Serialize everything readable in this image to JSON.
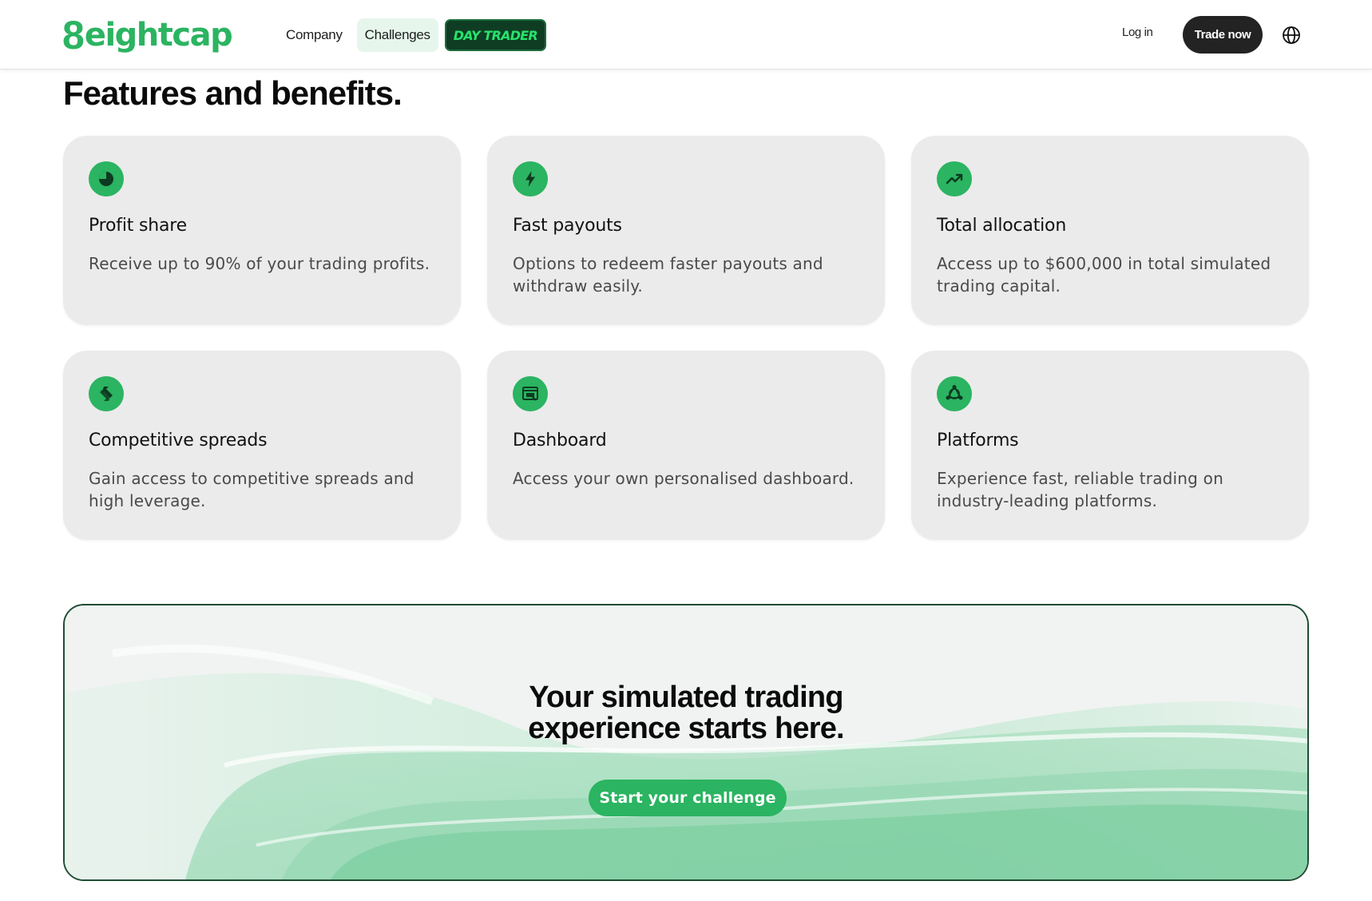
{
  "nav": {
    "logo_mark": "8",
    "logo_word": "eightcap",
    "links": [
      {
        "label": "Company"
      },
      {
        "label": "Challenges"
      }
    ],
    "badge_label": "DAY TRADER",
    "login_label": "Log in",
    "trade_label": "Trade now",
    "globe_icon": "globe-icon"
  },
  "features": {
    "title": "Features and benefits.",
    "cards": [
      {
        "icon": "pie-chart-icon",
        "title": "Profit share",
        "desc": "Receive up to 90% of your trading profits."
      },
      {
        "icon": "lightning-bolt-icon",
        "title": "Fast payouts",
        "desc": "Options to redeem faster payouts and withdraw easily."
      },
      {
        "icon": "trending-up-icon",
        "title": "Total allocation",
        "desc": "Access up to $600,000 in total simulated trading capital."
      },
      {
        "icon": "swap-arrows-icon",
        "title": "Competitive spreads",
        "desc": "Gain access to competitive spreads and high leverage."
      },
      {
        "icon": "dashboard-icon",
        "title": "Dashboard",
        "desc": "Access your own personalised dashboard."
      },
      {
        "icon": "platforms-icon",
        "title": "Platforms",
        "desc": "Experience fast, reliable trading on industry-leading platforms."
      }
    ]
  },
  "cta": {
    "title_line1": "Your simulated trading",
    "title_line2": "experience starts here.",
    "button_label": "Start your challenge"
  },
  "colors": {
    "brand_green": "#2bb461",
    "dark_green": "#0f3d24",
    "badge_text": "#28e36c",
    "card_bg": "#ebebeb",
    "trade_button": "#232323"
  }
}
